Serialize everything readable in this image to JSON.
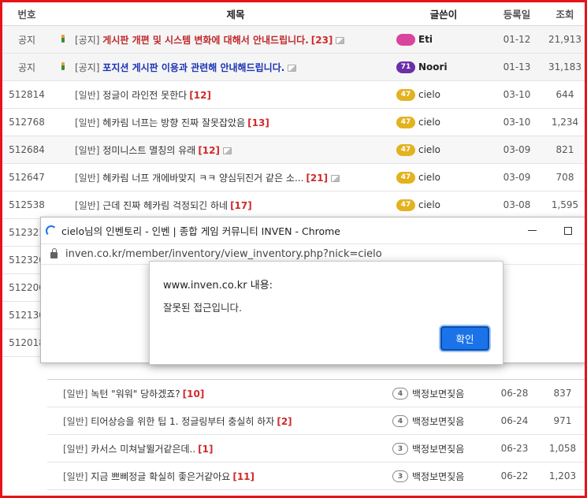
{
  "board": {
    "headers": {
      "no": "번호",
      "title": "제목",
      "writer": "글쓴이",
      "date": "등록일",
      "views": "조회"
    },
    "rows": [
      {
        "no": "공지",
        "category": "[공지]",
        "title": "게시판 개편 및 시스템 변화에 대해서 안내드립니다.",
        "comments": "[23]",
        "level": "",
        "writer": "Eti",
        "date": "01-12",
        "views": "21,913"
      },
      {
        "no": "공지",
        "category": "[공지]",
        "title": "포지션 게시판 이용과 관련해 안내해드립니다.",
        "comments": "",
        "level": "71",
        "writer": "Noori",
        "date": "01-13",
        "views": "31,183"
      },
      {
        "no": "512814",
        "category": "[일반]",
        "title": "정글이 라인전 못한다",
        "comments": "[12]",
        "level": "47",
        "writer": "cielo",
        "date": "03-10",
        "views": "644"
      },
      {
        "no": "512768",
        "category": "[일반]",
        "title": "헤카림 너프는 방향 진짜 잘못잡았음",
        "comments": "[13]",
        "level": "47",
        "writer": "cielo",
        "date": "03-10",
        "views": "1,234"
      },
      {
        "no": "512684",
        "category": "[일반]",
        "title": "정미니스트 멸칭의 유래",
        "comments": "[12]",
        "level": "47",
        "writer": "cielo",
        "date": "03-09",
        "views": "821"
      },
      {
        "no": "512647",
        "category": "[일반]",
        "title": "헤카림 너프 개에바맞지 ㅋㅋ 양심뒤진거 같은 소...",
        "comments": "[21]",
        "level": "47",
        "writer": "cielo",
        "date": "03-09",
        "views": "708"
      },
      {
        "no": "512538",
        "category": "[일반]",
        "title": "근데 진짜 헤카림 걱정되긴 하네",
        "comments": "[17]",
        "level": "47",
        "writer": "cielo",
        "date": "03-08",
        "views": "1,595"
      },
      {
        "no": "512321"
      },
      {
        "no": "512320"
      },
      {
        "no": "512200"
      },
      {
        "no": "512130"
      },
      {
        "no": "512018"
      }
    ]
  },
  "lower_list": [
    {
      "category": "[일반]",
      "title": "녹턴 \"워워\" 당하겠죠?",
      "comments": "[10]",
      "level": "4",
      "writer": "백정보면짖음",
      "date": "06-28",
      "views": "837"
    },
    {
      "category": "[일반]",
      "title": "티어상승을 위한 팁 1. 정글링부터 충실히 하자",
      "comments": "[2]",
      "level": "4",
      "writer": "백정보면짖음",
      "date": "06-24",
      "views": "971"
    },
    {
      "category": "[일반]",
      "title": "카서스 미쳐날뛸거같은데..",
      "comments": "[1]",
      "level": "3",
      "writer": "백정보면짖음",
      "date": "06-23",
      "views": "1,058"
    },
    {
      "category": "[일반]",
      "title": "지금 쁘삐정글 확실히 좋은거같아요",
      "comments": "[11]",
      "level": "3",
      "writer": "백정보면짖음",
      "date": "06-22",
      "views": "1,203"
    }
  ],
  "popup": {
    "window_title": "cielo님의 인벤토리 - 인벤 | 종합 게임 커뮤니티 INVEN - Chrome",
    "url": "inven.co.kr/member/inventory/view_inventory.php?nick=cielo"
  },
  "dialog": {
    "origin": "www.inven.co.kr 내용:",
    "message": "잘못된 접근입니다.",
    "ok_label": "확인"
  },
  "colors": {
    "frame_border": "#e5141b",
    "notice_red": "#c0282a",
    "notice_blue": "#1a33b3",
    "comment_red": "#d02a2a",
    "ok_button": "#1a73e8"
  }
}
